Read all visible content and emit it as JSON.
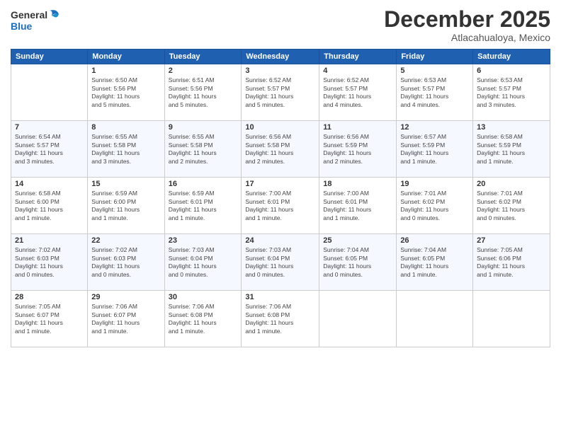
{
  "logo": {
    "line1": "General",
    "line2": "Blue"
  },
  "title": "December 2025",
  "location": "Atlacahualoya, Mexico",
  "headers": [
    "Sunday",
    "Monday",
    "Tuesday",
    "Wednesday",
    "Thursday",
    "Friday",
    "Saturday"
  ],
  "weeks": [
    [
      {
        "day": "",
        "info": ""
      },
      {
        "day": "1",
        "info": "Sunrise: 6:50 AM\nSunset: 5:56 PM\nDaylight: 11 hours\nand 5 minutes."
      },
      {
        "day": "2",
        "info": "Sunrise: 6:51 AM\nSunset: 5:56 PM\nDaylight: 11 hours\nand 5 minutes."
      },
      {
        "day": "3",
        "info": "Sunrise: 6:52 AM\nSunset: 5:57 PM\nDaylight: 11 hours\nand 5 minutes."
      },
      {
        "day": "4",
        "info": "Sunrise: 6:52 AM\nSunset: 5:57 PM\nDaylight: 11 hours\nand 4 minutes."
      },
      {
        "day": "5",
        "info": "Sunrise: 6:53 AM\nSunset: 5:57 PM\nDaylight: 11 hours\nand 4 minutes."
      },
      {
        "day": "6",
        "info": "Sunrise: 6:53 AM\nSunset: 5:57 PM\nDaylight: 11 hours\nand 3 minutes."
      }
    ],
    [
      {
        "day": "7",
        "info": "Sunrise: 6:54 AM\nSunset: 5:57 PM\nDaylight: 11 hours\nand 3 minutes."
      },
      {
        "day": "8",
        "info": "Sunrise: 6:55 AM\nSunset: 5:58 PM\nDaylight: 11 hours\nand 3 minutes."
      },
      {
        "day": "9",
        "info": "Sunrise: 6:55 AM\nSunset: 5:58 PM\nDaylight: 11 hours\nand 2 minutes."
      },
      {
        "day": "10",
        "info": "Sunrise: 6:56 AM\nSunset: 5:58 PM\nDaylight: 11 hours\nand 2 minutes."
      },
      {
        "day": "11",
        "info": "Sunrise: 6:56 AM\nSunset: 5:59 PM\nDaylight: 11 hours\nand 2 minutes."
      },
      {
        "day": "12",
        "info": "Sunrise: 6:57 AM\nSunset: 5:59 PM\nDaylight: 11 hours\nand 1 minute."
      },
      {
        "day": "13",
        "info": "Sunrise: 6:58 AM\nSunset: 5:59 PM\nDaylight: 11 hours\nand 1 minute."
      }
    ],
    [
      {
        "day": "14",
        "info": "Sunrise: 6:58 AM\nSunset: 6:00 PM\nDaylight: 11 hours\nand 1 minute."
      },
      {
        "day": "15",
        "info": "Sunrise: 6:59 AM\nSunset: 6:00 PM\nDaylight: 11 hours\nand 1 minute."
      },
      {
        "day": "16",
        "info": "Sunrise: 6:59 AM\nSunset: 6:01 PM\nDaylight: 11 hours\nand 1 minute."
      },
      {
        "day": "17",
        "info": "Sunrise: 7:00 AM\nSunset: 6:01 PM\nDaylight: 11 hours\nand 1 minute."
      },
      {
        "day": "18",
        "info": "Sunrise: 7:00 AM\nSunset: 6:01 PM\nDaylight: 11 hours\nand 1 minute."
      },
      {
        "day": "19",
        "info": "Sunrise: 7:01 AM\nSunset: 6:02 PM\nDaylight: 11 hours\nand 0 minutes."
      },
      {
        "day": "20",
        "info": "Sunrise: 7:01 AM\nSunset: 6:02 PM\nDaylight: 11 hours\nand 0 minutes."
      }
    ],
    [
      {
        "day": "21",
        "info": "Sunrise: 7:02 AM\nSunset: 6:03 PM\nDaylight: 11 hours\nand 0 minutes."
      },
      {
        "day": "22",
        "info": "Sunrise: 7:02 AM\nSunset: 6:03 PM\nDaylight: 11 hours\nand 0 minutes."
      },
      {
        "day": "23",
        "info": "Sunrise: 7:03 AM\nSunset: 6:04 PM\nDaylight: 11 hours\nand 0 minutes."
      },
      {
        "day": "24",
        "info": "Sunrise: 7:03 AM\nSunset: 6:04 PM\nDaylight: 11 hours\nand 0 minutes."
      },
      {
        "day": "25",
        "info": "Sunrise: 7:04 AM\nSunset: 6:05 PM\nDaylight: 11 hours\nand 0 minutes."
      },
      {
        "day": "26",
        "info": "Sunrise: 7:04 AM\nSunset: 6:05 PM\nDaylight: 11 hours\nand 1 minute."
      },
      {
        "day": "27",
        "info": "Sunrise: 7:05 AM\nSunset: 6:06 PM\nDaylight: 11 hours\nand 1 minute."
      }
    ],
    [
      {
        "day": "28",
        "info": "Sunrise: 7:05 AM\nSunset: 6:07 PM\nDaylight: 11 hours\nand 1 minute."
      },
      {
        "day": "29",
        "info": "Sunrise: 7:06 AM\nSunset: 6:07 PM\nDaylight: 11 hours\nand 1 minute."
      },
      {
        "day": "30",
        "info": "Sunrise: 7:06 AM\nSunset: 6:08 PM\nDaylight: 11 hours\nand 1 minute."
      },
      {
        "day": "31",
        "info": "Sunrise: 7:06 AM\nSunset: 6:08 PM\nDaylight: 11 hours\nand 1 minute."
      },
      {
        "day": "",
        "info": ""
      },
      {
        "day": "",
        "info": ""
      },
      {
        "day": "",
        "info": ""
      }
    ]
  ]
}
